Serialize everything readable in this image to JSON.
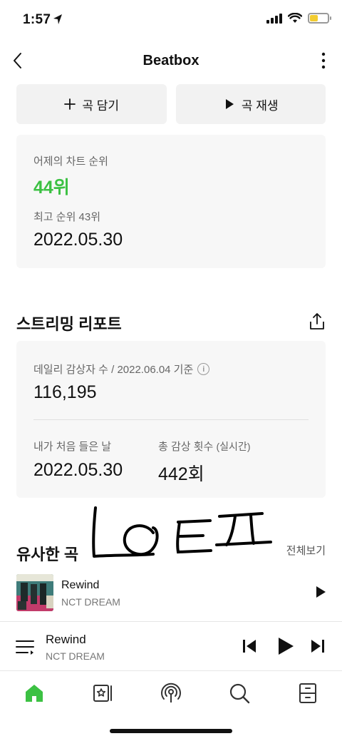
{
  "status_bar": {
    "time": "1:57"
  },
  "header": {
    "title": "Beatbox"
  },
  "actions": {
    "add_label": "곡 담기",
    "play_label": "곡 재생"
  },
  "chart_rank": {
    "label": "어제의 차트 순위",
    "rank": "44위",
    "best_label": "최고 순위 43위",
    "best_date": "2022.05.30"
  },
  "streaming_report": {
    "title": "스트리밍 리포트",
    "daily_label": "데일리 감상자 수 / 2022.06.04 기준",
    "info_glyph": "i",
    "daily_listeners": "116,195",
    "first_listen_label": "내가 처음 들은 날",
    "first_listen_date": "2022.05.30",
    "total_plays_label": "총 감상 횟수",
    "total_plays_sub": "(실시간)",
    "total_plays": "442회"
  },
  "similar": {
    "title": "유사한 곡",
    "see_all": "전체보기",
    "songs": [
      {
        "title": "Rewind",
        "artist": "NCT DREAM"
      }
    ]
  },
  "mini_player": {
    "title": "Rewind",
    "artist": "NCT DREAM"
  },
  "colors": {
    "accent_green": "#3cc143",
    "battery_yellow": "#f2cc31"
  },
  "icons": {
    "tabs": [
      "home-icon",
      "library-icon",
      "podcast-icon",
      "search-icon",
      "drawer-icon"
    ]
  }
}
